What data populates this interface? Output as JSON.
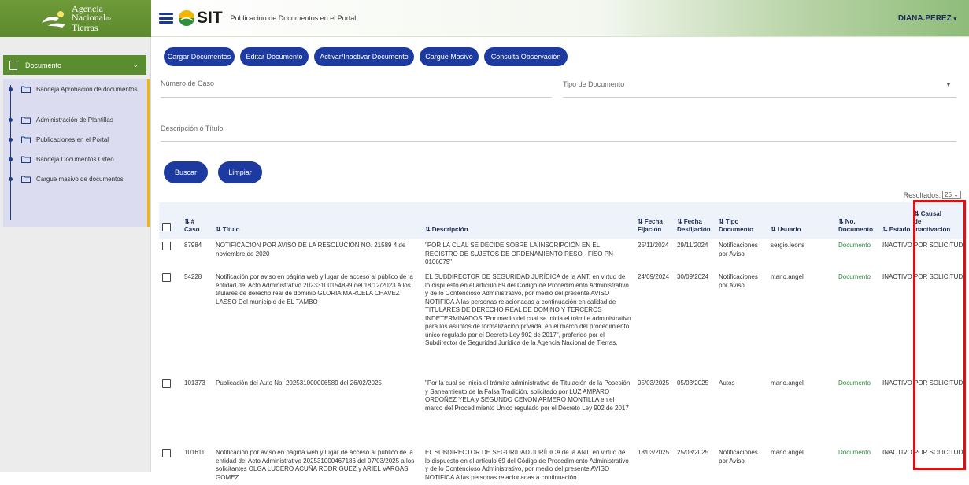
{
  "brand": {
    "line1": "Agencia",
    "line2": "Nacional",
    "line3": "Tierras",
    "small": "de"
  },
  "header": {
    "app_name": "SIT",
    "page_title": "Publicación de Documentos en el Portal",
    "user": "DIANA.PEREZ"
  },
  "sidebar": {
    "section": "Documento",
    "items": [
      {
        "label": "Bandeja Aprobación de documentos"
      },
      {
        "label": "Administración de Plantillas"
      },
      {
        "label": "Publicaciones en el Portal"
      },
      {
        "label": "Bandeja Documentos Orfeo"
      },
      {
        "label": "Cargue masivo de documentos"
      }
    ]
  },
  "actions": {
    "cargar": "Cargar Documentos",
    "editar": "Editar Documento",
    "activar": "Activar/Inactivar Documento",
    "cargue_masivo": "Cargue Masivo",
    "consulta": "Consulta Observación"
  },
  "filters": {
    "numero_caso": "Número de Caso",
    "tipo_documento": "Tipo de Documento",
    "descripcion": "Descripción ó Título",
    "buscar": "Buscar",
    "limpiar": "Limpiar"
  },
  "results": {
    "label": "Resultados:",
    "value": "25"
  },
  "table": {
    "headers": {
      "caso": "#",
      "caso2": "Caso",
      "titulo": "Título",
      "descripcion": "Descripción",
      "fecha_fijacion": "Fecha",
      "fecha_fijacion2": "Fijación",
      "fecha_desfijacion": "Fecha",
      "fecha_desfijacion2": "Desfijación",
      "tipo": "Tipo",
      "tipo2": "Documento",
      "usuario": "Usuario",
      "no_doc": "No.",
      "no_doc2": "Documento",
      "estado": "Estado",
      "causal": "Causal",
      "causal2": "de",
      "causal3": "Inactivación"
    },
    "rows": [
      {
        "caso": "87984",
        "titulo": "NOTIFICACION POR AVISO DE LA RESOLUCIÓN NO. 21589 4 de noviembre de 2020",
        "descripcion": "\"POR LA CUAL SE DECIDE SOBRE LA INSCRIPCIÓN EN EL REGISTRO DE SUJETOS DE ORDENAMIENTO RESO - FISO PN-0106079\"",
        "fecha_fijacion": "25/11/2024",
        "fecha_desfijacion": "29/11/2024",
        "tipo": "Notificaciones por Aviso",
        "usuario": "sergio.leons",
        "documento": "Documento",
        "estado": "INACTIVO",
        "causal": "POR SOLICITUD"
      },
      {
        "caso": "54228",
        "titulo": "Notificación por aviso en página web y lugar de acceso al público de la entidad del Acto Administrativo 20233100154899 del 18/12/2023 A los titulares de derecho real de dominio GLORIA MARCELA CHAVEZ LASSO Del municipio de EL TAMBO",
        "descripcion": "EL SUBDIRECTOR DE SEGURIDAD JURÍDICA de la ANT, en virtud de lo dispuesto en el artículo 69 del Código de Procedimiento Administrativo y de lo Contencioso Administrativo, por medio del presente AVISO NOTIFICA A las personas relacionadas a continuación en calidad de TITULARES DE DERECHO REAL DE DOMINO Y TERCEROS INDETERMINADOS \"Por medio del cual se inicia el trámite administrativo para los asuntos de formalización privada, en el marco del procedimiento único regulado por el Decreto Ley 902 de 2017\", proferido por el Subdirector de Seguridad Jurídica de la Agencia Nacional de Tierras.",
        "fecha_fijacion": "24/09/2024",
        "fecha_desfijacion": "30/09/2024",
        "tipo": "Notificaciones por Aviso",
        "usuario": "mario.angel",
        "documento": "Documento",
        "estado": "INACTIVO",
        "causal": "POR SOLICITUD"
      },
      {
        "caso": "101373",
        "titulo": "Publicación del Auto No. 202531000006589 del 26/02/2025",
        "descripcion": "\"Por la cual se inicia el trámite administrativo de Titulación de la Posesión y Saneamiento de la Falsa Tradición, solicitado por LUZ AMPARO ORDOÑEZ YELA y SEGUNDO CENON ARMERO MONTILLA en el marco del Procedimiento Único regulado por el Decreto Ley 902 de 2017",
        "fecha_fijacion": "05/03/2025",
        "fecha_desfijacion": "05/03/2025",
        "tipo": "Autos",
        "usuario": "mario.angel",
        "documento": "Documento",
        "estado": "INACTIVO",
        "causal": "POR SOLICITUD"
      },
      {
        "caso": "101611",
        "titulo": "Notificación por aviso en página web y lugar de acceso al público de la entidad del Acto Administrativo 202531000467186 del 07/03/2025 a los solicitantes OLGA LUCERO ACUÑA RODRIGUEZ y ARIEL VARGAS GOMEZ",
        "descripcion": "EL SUBDIRECTOR DE SEGURIDAD JURÍDICA de la ANT, en virtud de lo dispuesto en el artículo 69 del Código de Procedimiento Administrativo y de lo Contencioso Administrativo, por medio del presente AVISO NOTIFICA A las personas relacionadas a continuación",
        "fecha_fijacion": "18/03/2025",
        "fecha_desfijacion": "25/03/2025",
        "tipo": "Notificaciones por Aviso",
        "usuario": "mario.angel",
        "documento": "Documento",
        "estado": "INACTIVO",
        "causal": "POR SOLICITUD"
      }
    ]
  },
  "colors": {
    "primary_button": "#1c3aa0",
    "brand_green": "#5a8d2f",
    "link_green": "#2e8b3c",
    "highlight": "#e01010",
    "sidebar_accent": "#f2b705"
  }
}
